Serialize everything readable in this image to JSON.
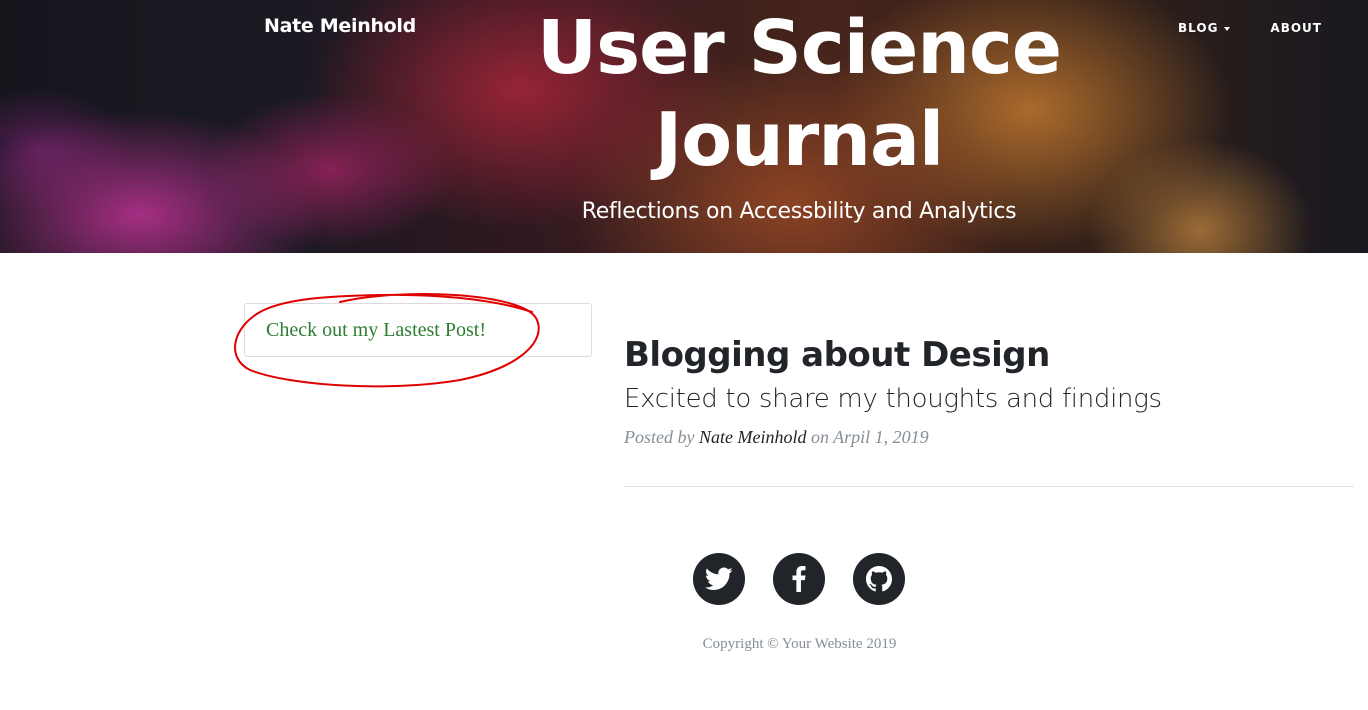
{
  "header": {
    "brand": "Nate Meinhold",
    "nav": [
      {
        "label": "Blog",
        "has_dropdown": true
      },
      {
        "label": "About",
        "has_dropdown": false
      }
    ],
    "site_title": "User Science Journal",
    "site_subtitle": "Reflections on Accessbility and Analytics"
  },
  "sidebar": {
    "callout_link": "Check out my Lastest Post!",
    "annotation_color": "#e00000"
  },
  "post": {
    "title": "Blogging about Design",
    "subtitle": "Excited to share my thoughts and findings",
    "meta_prefix": "Posted by",
    "author": "Nate Meinhold",
    "meta_on": "on",
    "date": "Arpil 1, 2019"
  },
  "footer": {
    "social": [
      {
        "icon": "twitter-icon"
      },
      {
        "icon": "facebook-icon"
      },
      {
        "icon": "github-icon"
      }
    ],
    "copyright": "Copyright © Your Website 2019"
  },
  "colors": {
    "link_green": "#2e7d32",
    "text_dark": "#212529",
    "muted": "#868e96"
  }
}
